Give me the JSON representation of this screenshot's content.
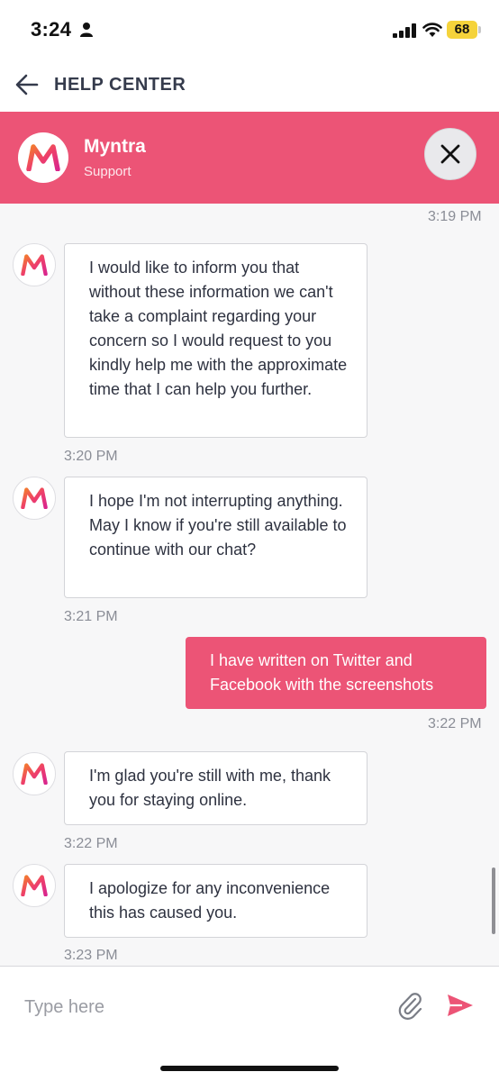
{
  "status_bar": {
    "time": "3:24",
    "battery": "68",
    "icons": [
      "person-icon",
      "signal-icon",
      "wifi-icon",
      "battery-icon"
    ]
  },
  "header": {
    "title": "HELP CENTER",
    "back_icon": "back-arrow-icon"
  },
  "banner": {
    "brand_name": "Myntra",
    "subtitle": "Support",
    "close_icon": "close-icon",
    "color": "#ec5476"
  },
  "chat": {
    "top_timestamp": "3:19 PM",
    "messages": [
      {
        "from": "agent",
        "text": "I would like to inform you that without these information we can't take a complaint regarding your concern so I would request to you kindly help me with the approximate time that I can help you further.",
        "time": "3:20 PM"
      },
      {
        "from": "agent",
        "text": "I hope I'm not interrupting anything. May I know if you're still available to continue with our chat?",
        "time": "3:21 PM"
      },
      {
        "from": "user",
        "text": "I have written on Twitter and Facebook with the screenshots",
        "time": "3:22 PM"
      },
      {
        "from": "agent",
        "text": "I'm glad you're still with me, thank you for staying online.",
        "time": "3:22 PM"
      },
      {
        "from": "agent",
        "text": "I apologize for any inconvenience this has caused you.",
        "time": "3:23 PM"
      }
    ]
  },
  "composer": {
    "placeholder": "Type here",
    "value": "",
    "attach_icon": "paperclip-icon",
    "send_icon": "send-icon"
  },
  "colors": {
    "accent": "#ec5476",
    "background": "#f7f7f8",
    "text": "#2e3240"
  }
}
